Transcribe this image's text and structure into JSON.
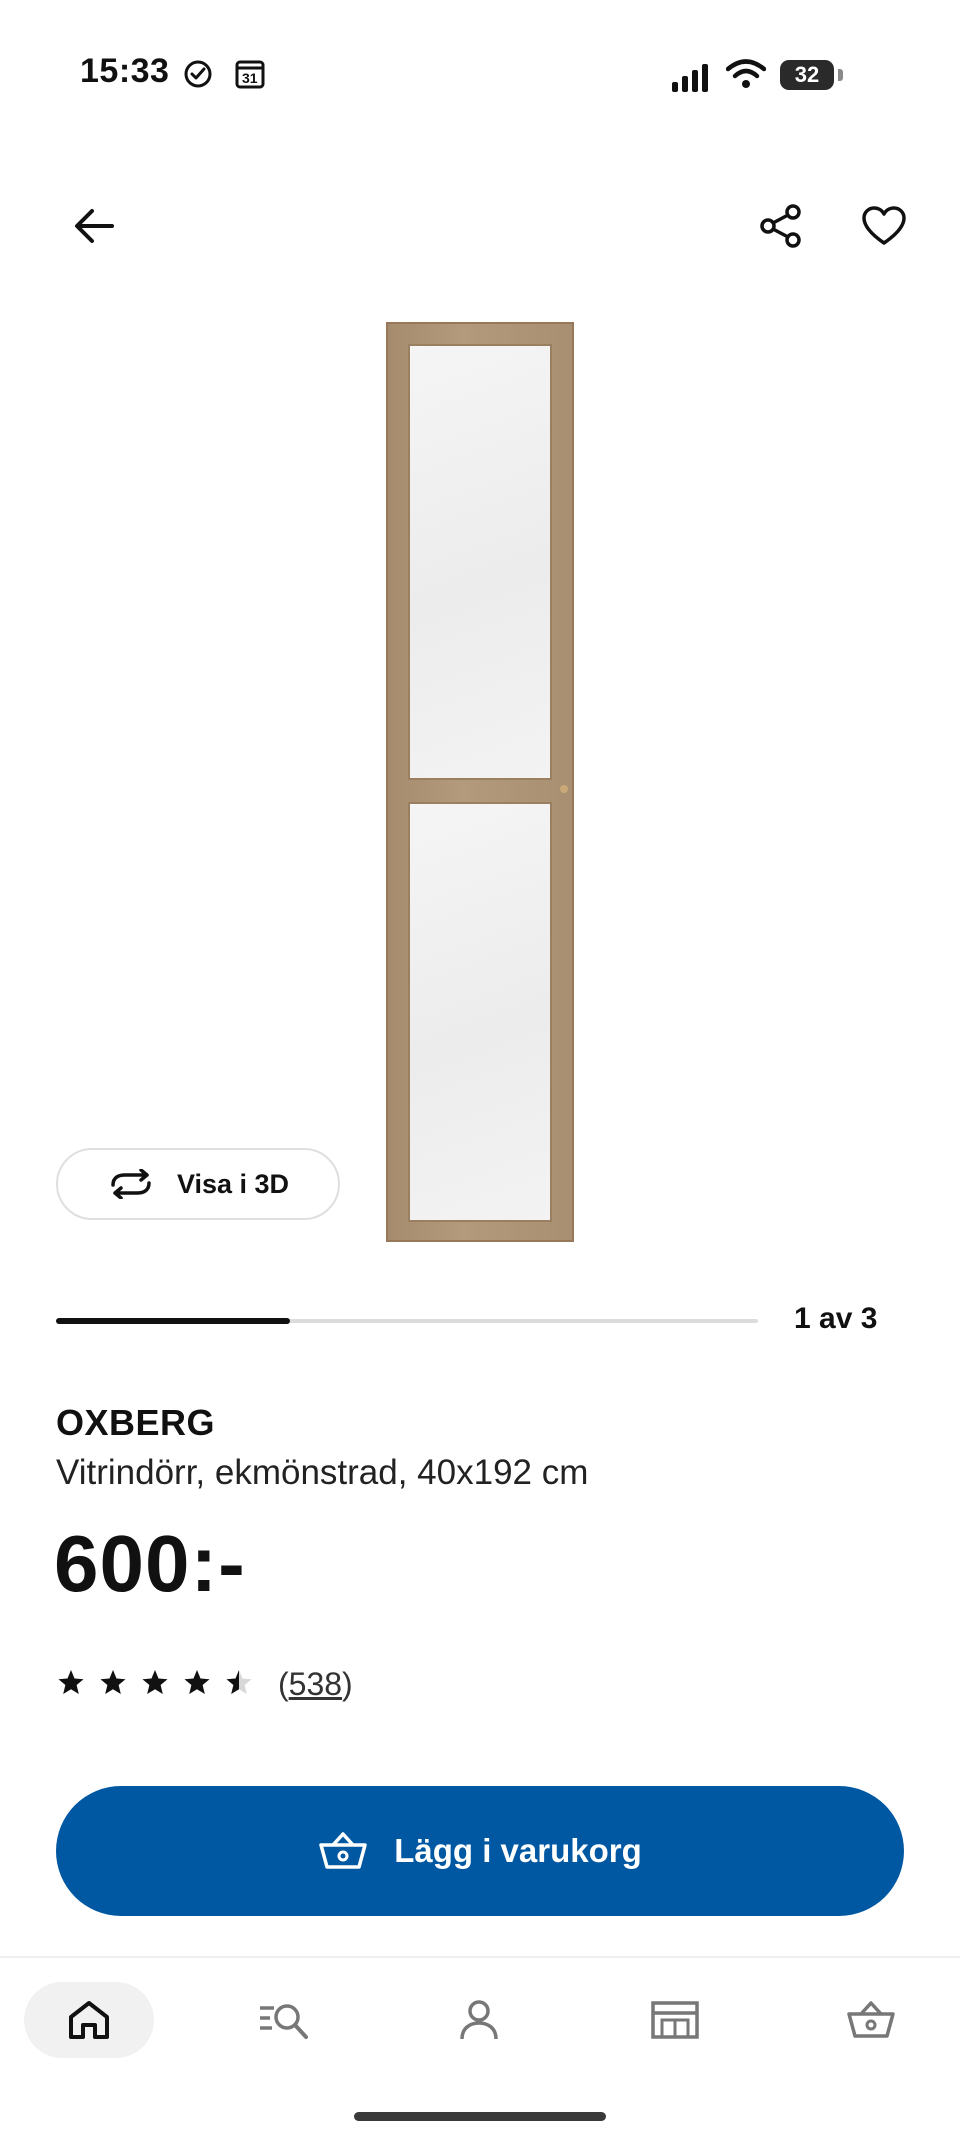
{
  "status_bar": {
    "time": "15:33",
    "calendar_day": "31",
    "battery": "32",
    "icons": [
      "check-circle-icon",
      "calendar-icon",
      "signal-icon",
      "wifi-icon",
      "battery-icon"
    ]
  },
  "header": {
    "icons": [
      "back-arrow-icon",
      "share-icon",
      "heart-icon"
    ]
  },
  "gallery": {
    "view3d_label": "Visa i 3D",
    "counter": "1 av 3",
    "progress": 0.333
  },
  "product": {
    "name": "OXBERG",
    "description": "Vitrindörr, ekmönstrad, 40x192 cm",
    "price": "600:-",
    "rating": 4.5,
    "reviews_open": "(",
    "review_count": "538",
    "reviews_close": ")"
  },
  "cart_button": {
    "label": "Lägg i varukorg",
    "icon": "basket-icon"
  },
  "bottom_nav": {
    "items": [
      "home-icon",
      "search-list-icon",
      "profile-icon",
      "store-icon",
      "basket-icon"
    ],
    "active": "home-icon"
  },
  "colors": {
    "brand_blue": "#0058a3",
    "text": "#111111",
    "track": "#dcdcdc"
  }
}
